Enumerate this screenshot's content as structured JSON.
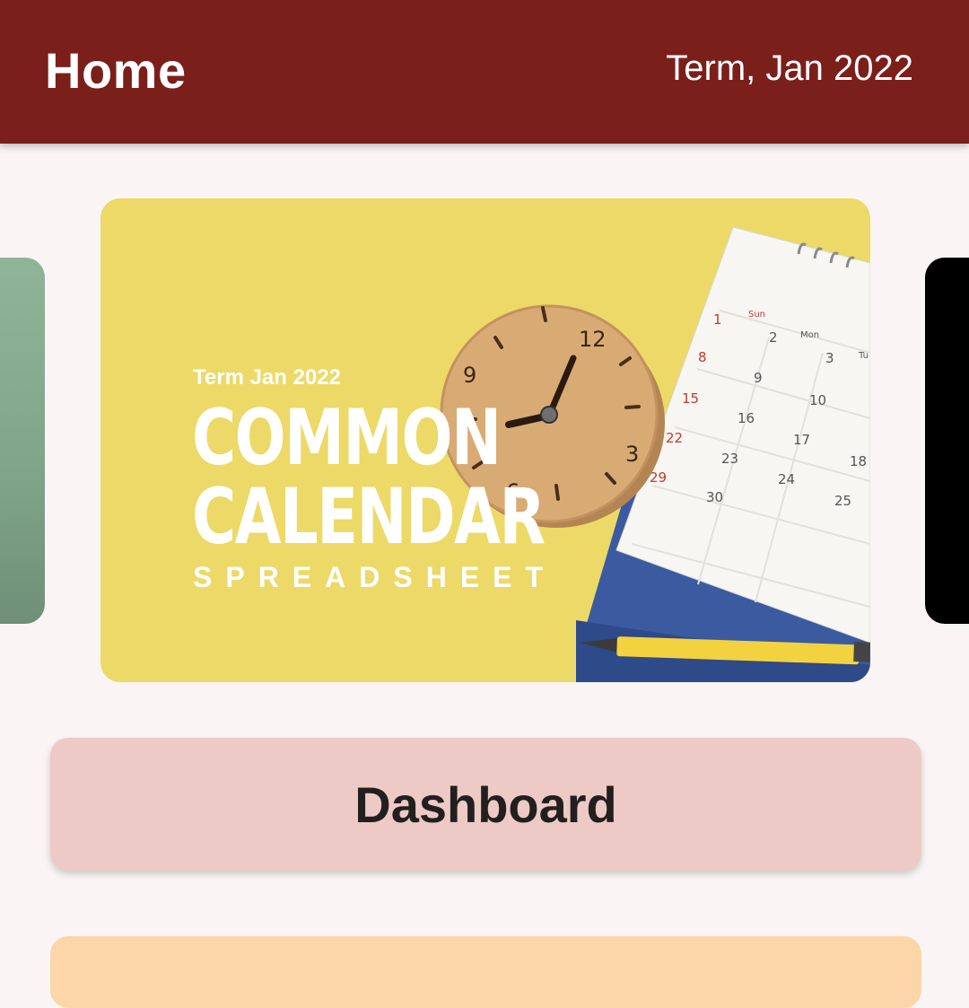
{
  "app_bar": {
    "title": "Home",
    "term": "Term, Jan 2022",
    "background": "#7b1f1b"
  },
  "carousel": {
    "banner": {
      "subtitle": "Term Jan 2022",
      "line1": "COMMON",
      "line2": "CALENDAR",
      "line3": "SPREADSHEET",
      "background": "#ecd967"
    },
    "left_card_color": "#8fb497",
    "right_card_color": "#000000"
  },
  "actions": {
    "dashboard_label": "Dashboard",
    "dashboard_color": "#edcac5",
    "next_card_color": "#fcd6a8"
  }
}
